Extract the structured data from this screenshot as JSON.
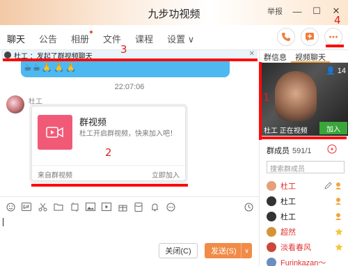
{
  "window": {
    "title": "九步功视频",
    "report_label": "举报",
    "minimize": "—",
    "maximize": "☐",
    "close": "✕"
  },
  "tabs": [
    {
      "label": "聊天",
      "active": true
    },
    {
      "label": "公告"
    },
    {
      "label": "相册",
      "dot": true
    },
    {
      "label": "文件"
    },
    {
      "label": "课程"
    },
    {
      "label": "设置 ∨"
    }
  ],
  "markers": {
    "m1": "1",
    "m2": "2",
    "m3": "3",
    "m4": "4"
  },
  "notice": {
    "text": "杜工 ：发起了群视频聊天",
    "close": "✕"
  },
  "chat": {
    "emoji_row": "☕☕🙏🙏🙏",
    "timestamp": "22:07:06",
    "sender": "杜工",
    "card": {
      "title": "群视频",
      "desc": "杜工开启群视频，快来加入吧！",
      "source": "来自群视频",
      "join": "立即加入"
    }
  },
  "input": {
    "close_label": "关闭(C)",
    "send_label": "发送(S)",
    "send_arrow": "∨"
  },
  "right_panel": {
    "tabs": [
      "群信息",
      "视频聊天"
    ],
    "video": {
      "live_count": "14",
      "status": "杜工 正在视频",
      "join": "加入"
    },
    "members_label": "群成员",
    "members_count": "591/1",
    "search_placeholder": "搜索群成员",
    "members": [
      {
        "name": "杜工",
        "style": "red"
      },
      {
        "name": "杜工",
        "style": "dark"
      },
      {
        "name": "杜工",
        "style": "dark"
      },
      {
        "name": "超然",
        "style": "red"
      },
      {
        "name": "淡看春风",
        "style": "red"
      },
      {
        "name": "Furinkazan～",
        "style": "red"
      }
    ]
  },
  "colors": {
    "accent": "#f5a33c",
    "marker_red": "#ff0a0a",
    "send_orange": "#f08b48",
    "join_green": "#3aa63a",
    "card_pink": "#f15a77",
    "bubble_blue": "#4eb8f0"
  }
}
